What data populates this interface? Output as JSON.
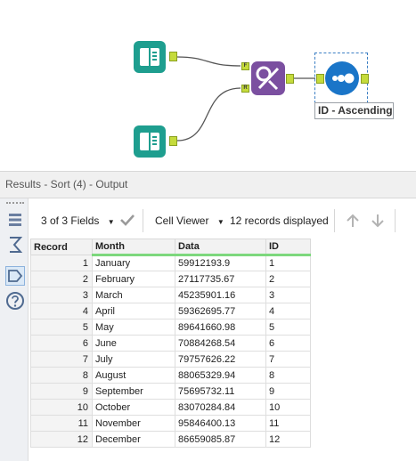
{
  "workflow": {
    "sort_caption": "ID - Ascending",
    "join_anchor_left_top": "F",
    "join_anchor_left_bottom": "R"
  },
  "results": {
    "title": "Results - Sort (4) - Output",
    "fields_label": "3 of 3 Fields",
    "viewer_label": "Cell Viewer",
    "records_label": "12 records displayed"
  },
  "grid": {
    "columns": [
      "Record",
      "Month",
      "Data",
      "ID"
    ],
    "rows": [
      {
        "record": "1",
        "month": "January",
        "data": "59912193.9",
        "id": "1"
      },
      {
        "record": "2",
        "month": "February",
        "data": "27117735.67",
        "id": "2"
      },
      {
        "record": "3",
        "month": "March",
        "data": "45235901.16",
        "id": "3"
      },
      {
        "record": "4",
        "month": "April",
        "data": "59362695.77",
        "id": "4"
      },
      {
        "record": "5",
        "month": "May",
        "data": "89641660.98",
        "id": "5"
      },
      {
        "record": "6",
        "month": "June",
        "data": "70884268.54",
        "id": "6"
      },
      {
        "record": "7",
        "month": "July",
        "data": "79757626.22",
        "id": "7"
      },
      {
        "record": "8",
        "month": "August",
        "data": "88065329.94",
        "id": "8"
      },
      {
        "record": "9",
        "month": "September",
        "data": "75695732.11",
        "id": "9"
      },
      {
        "record": "10",
        "month": "October",
        "data": "83070284.84",
        "id": "10"
      },
      {
        "record": "11",
        "month": "November",
        "data": "95846400.13",
        "id": "11"
      },
      {
        "record": "12",
        "month": "December",
        "data": "86659085.87",
        "id": "12"
      }
    ]
  },
  "icons": {
    "input_tool": "book-input-icon",
    "join_tool": "join-icon",
    "sort_tool": "sort-icon",
    "rail": [
      "list-icon",
      "sigma-icon",
      "tag-icon",
      "help-icon"
    ],
    "toolbar": [
      "chevron-down-icon",
      "checkmark-icon",
      "chevron-down-icon",
      "arrow-up-icon",
      "arrow-down-icon"
    ]
  },
  "colors": {
    "input_tool": "#1e9e8f",
    "join_tool": "#7b4fa0",
    "sort_tool": "#1a75c8",
    "anchor": "#c5db3c",
    "header_underline": "#7dd87d"
  }
}
